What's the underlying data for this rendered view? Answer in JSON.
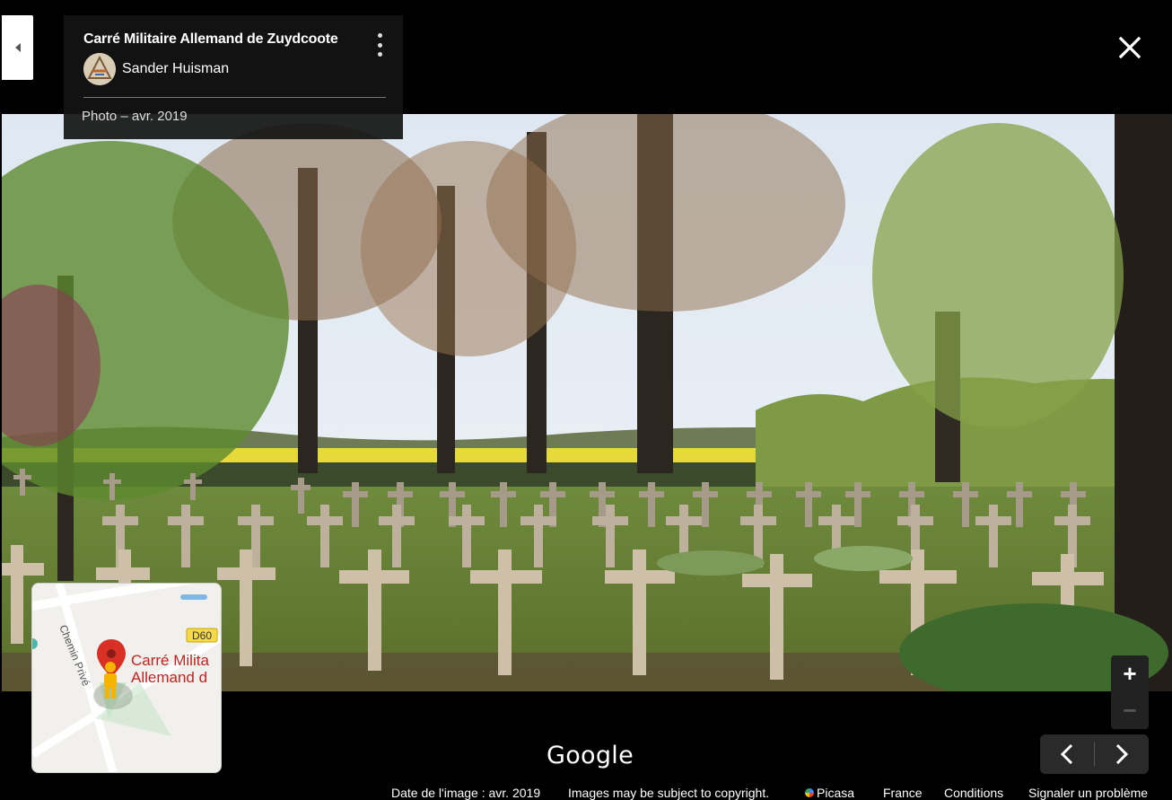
{
  "panel": {
    "title": "Carré Militaire Allemand de Zuydcoote",
    "author": "Sander Huisman",
    "photo_date": "Photo – avr. 2019"
  },
  "icons": {
    "collapse": "collapse-left-icon",
    "more": "more-vert-icon",
    "close": "close-icon",
    "zoom_in": "plus-icon",
    "zoom_out": "minus-icon",
    "prev": "chevron-left-icon",
    "next": "chevron-right-icon",
    "pegman": "pegman-icon",
    "pin": "map-pin-icon"
  },
  "minimap": {
    "road_label": "Chemin Privé",
    "route_badge": "D60",
    "place_line1": "Carré Milita",
    "place_line2": "Allemand d"
  },
  "controls": {
    "zoom_in": "+",
    "zoom_out": "−"
  },
  "branding": {
    "logo": "Google"
  },
  "footer": {
    "image_date": "Date de l'image : avr. 2019",
    "copyright": "Images may be subject to copyright.",
    "picasa": "Picasa",
    "country": "France",
    "terms": "Conditions",
    "report": "Signaler un problème"
  },
  "colors": {
    "background": "#000000",
    "pin_red": "#d93025",
    "pegman_yellow": "#f4b400",
    "route_badge_bg": "#f6d94a"
  }
}
